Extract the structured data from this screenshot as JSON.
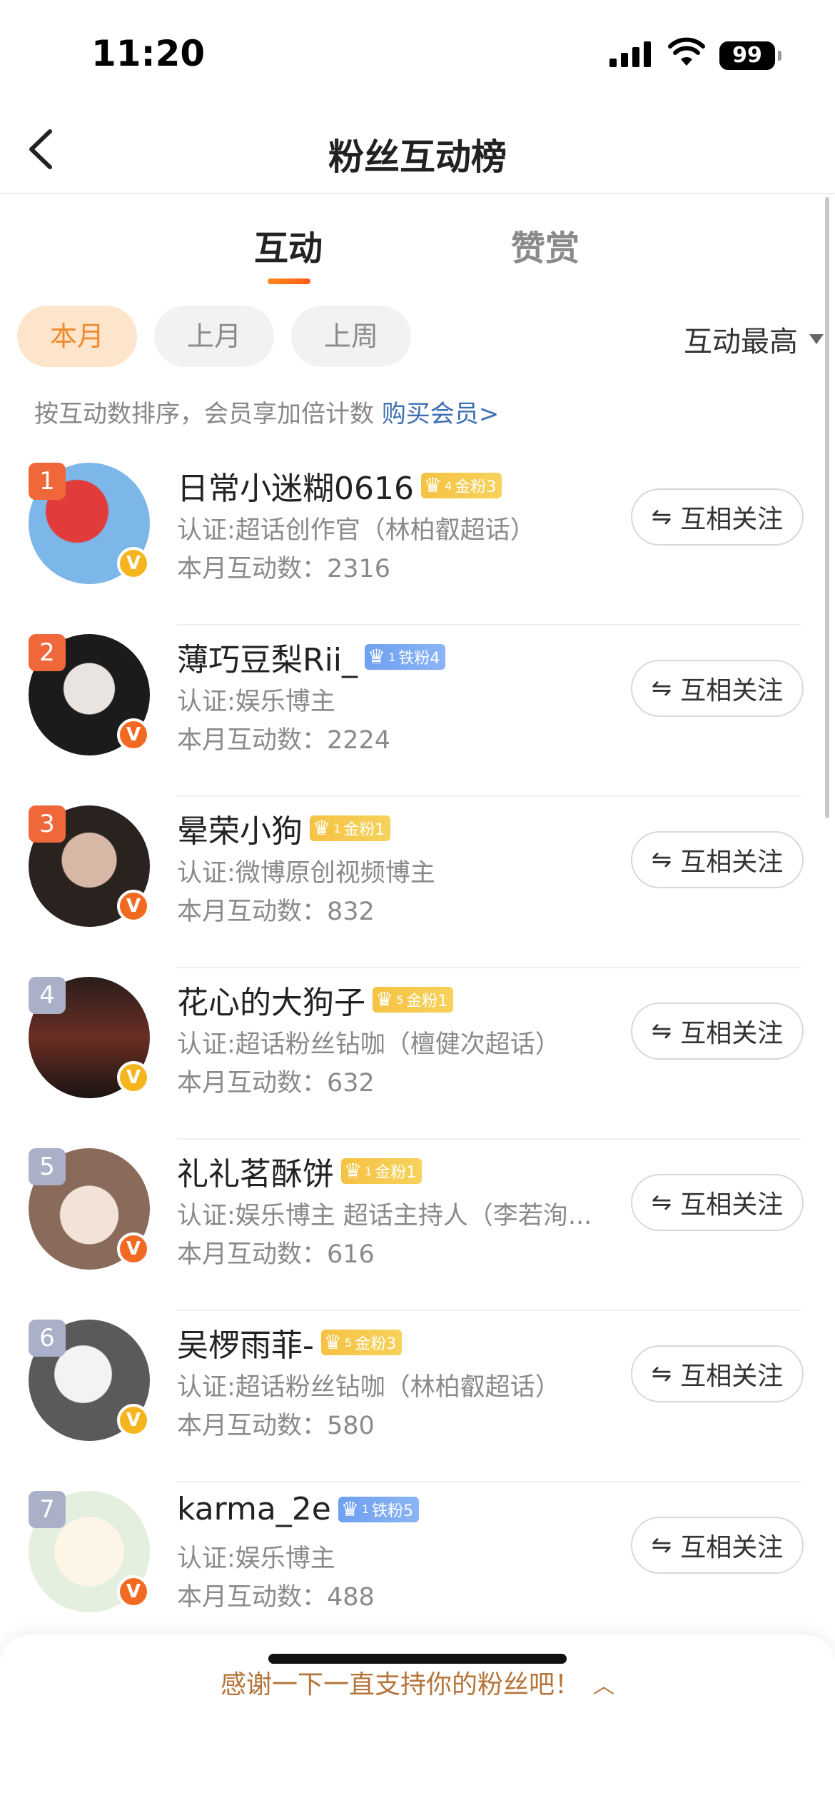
{
  "status": {
    "time": "11:20",
    "battery": "99"
  },
  "nav": {
    "title": "粉丝互动榜"
  },
  "tabs": [
    {
      "label": "互动"
    },
    {
      "label": "赞赏"
    }
  ],
  "filters": [
    {
      "label": "本月"
    },
    {
      "label": "上月"
    },
    {
      "label": "上周"
    }
  ],
  "sort": {
    "label": "互动最高"
  },
  "hint": {
    "text": "按互动数排序，会员享加倍计数 ",
    "link": "购买会员>"
  },
  "fans": [
    {
      "rank": "1",
      "name": "日常小迷糊0616",
      "badge": "金粉3",
      "badge_level": "4",
      "badge_type": "gold",
      "cert": "认证:超话创作官（林柏叡超话）",
      "count": "本月互动数：2316",
      "follow": "互相关注",
      "verify": "gold"
    },
    {
      "rank": "2",
      "name": "薄巧豆梨Rii_",
      "badge": "铁粉4",
      "badge_level": "1",
      "badge_type": "iron",
      "cert": "认证:娱乐博主",
      "count": "本月互动数：2224",
      "follow": "互相关注",
      "verify": "orange"
    },
    {
      "rank": "3",
      "name": "晕荣小狗",
      "badge": "金粉1",
      "badge_level": "1",
      "badge_type": "gold",
      "cert": "认证:微博原创视频博主",
      "count": "本月互动数：832",
      "follow": "互相关注",
      "verify": "orange"
    },
    {
      "rank": "4",
      "name": "花心的大狗子",
      "badge": "金粉1",
      "badge_level": "5",
      "badge_type": "gold",
      "cert": "认证:超话粉丝钻咖（檀健次超话）",
      "count": "本月互动数：632",
      "follow": "互相关注",
      "verify": "gold"
    },
    {
      "rank": "5",
      "name": "礼礼茗酥饼",
      "badge": "金粉1",
      "badge_level": "1",
      "badge_type": "gold",
      "cert": "认证:娱乐博主 超话主持人（李若洵...",
      "count": "本月互动数：616",
      "follow": "互相关注",
      "verify": "orange"
    },
    {
      "rank": "6",
      "name": "吴椤雨菲-",
      "badge": "金粉3",
      "badge_level": "5",
      "badge_type": "gold",
      "cert": "认证:超话粉丝钻咖（林柏叡超话）",
      "count": "本月互动数：580",
      "follow": "互相关注",
      "verify": "gold"
    },
    {
      "rank": "7",
      "name": "karma_2e",
      "badge": "铁粉5",
      "badge_level": "1",
      "badge_type": "iron",
      "cert": "认证:娱乐博主",
      "count": "本月互动数：488",
      "follow": "互相关注",
      "verify": "orange"
    }
  ],
  "footer": {
    "text": "感谢一下一直支持你的粉丝吧！"
  },
  "colors": {
    "accent": "#f08a2c",
    "rank_top": "#f0673a",
    "rank_other": "#a9b0c8",
    "verify_gold": "#f5b51e",
    "verify_orange": "#f26a22",
    "link": "#3e6fb3"
  }
}
